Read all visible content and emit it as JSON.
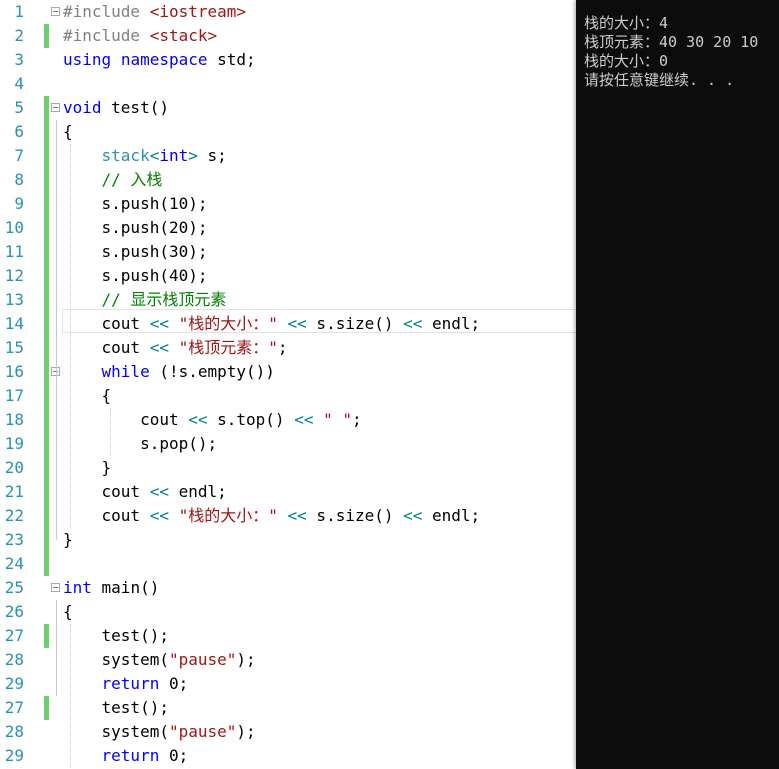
{
  "editor": {
    "lines": [
      {
        "n": "1",
        "tokens": [
          {
            "t": "#include ",
            "c": "p"
          },
          {
            "t": "<iostream>",
            "c": "s"
          }
        ]
      },
      {
        "n": "2",
        "tokens": [
          {
            "t": "#include ",
            "c": "p"
          },
          {
            "t": "<stack>",
            "c": "s"
          }
        ]
      },
      {
        "n": "3",
        "tokens": [
          {
            "t": "using",
            "c": "k"
          },
          {
            "t": " "
          },
          {
            "t": "namespace",
            "c": "k"
          },
          {
            "t": " std;"
          }
        ]
      },
      {
        "n": "4",
        "tokens": []
      },
      {
        "n": "5",
        "tokens": [
          {
            "t": "void",
            "c": "k"
          },
          {
            "t": " test()"
          }
        ]
      },
      {
        "n": "6",
        "tokens": [
          {
            "t": "{"
          }
        ]
      },
      {
        "n": "7",
        "tokens": [
          {
            "t": "    "
          },
          {
            "t": "stack",
            "c": "t"
          },
          {
            "t": "<",
            "c": "o"
          },
          {
            "t": "int",
            "c": "k"
          },
          {
            "t": ">",
            "c": "o"
          },
          {
            "t": " s;"
          }
        ]
      },
      {
        "n": "8",
        "tokens": [
          {
            "t": "    "
          },
          {
            "t": "// 入栈",
            "c": "c"
          }
        ]
      },
      {
        "n": "9",
        "tokens": [
          {
            "t": "    s.push(10);"
          }
        ]
      },
      {
        "n": "10",
        "tokens": [
          {
            "t": "    s.push(20);"
          }
        ]
      },
      {
        "n": "11",
        "tokens": [
          {
            "t": "    s.push(30);"
          }
        ]
      },
      {
        "n": "12",
        "tokens": [
          {
            "t": "    s.push(40);"
          }
        ]
      },
      {
        "n": "13",
        "tokens": [
          {
            "t": "    "
          },
          {
            "t": "// 显示栈顶元素",
            "c": "c"
          }
        ]
      },
      {
        "n": "14",
        "tokens": [
          {
            "t": "    cout "
          },
          {
            "t": "<<",
            "c": "o"
          },
          {
            "t": " "
          },
          {
            "t": "\"栈的大小：\"",
            "c": "s"
          },
          {
            "t": " "
          },
          {
            "t": "<<",
            "c": "o"
          },
          {
            "t": " s.size() "
          },
          {
            "t": "<<",
            "c": "o"
          },
          {
            "t": " endl;"
          }
        ]
      },
      {
        "n": "15",
        "tokens": [
          {
            "t": "    cout "
          },
          {
            "t": "<<",
            "c": "o"
          },
          {
            "t": " "
          },
          {
            "t": "\"栈顶元素：\"",
            "c": "s"
          },
          {
            "t": ";"
          }
        ]
      },
      {
        "n": "16",
        "tokens": [
          {
            "t": "    "
          },
          {
            "t": "while",
            "c": "k"
          },
          {
            "t": " (!s.empty())"
          }
        ]
      },
      {
        "n": "17",
        "tokens": [
          {
            "t": "    {"
          }
        ]
      },
      {
        "n": "18",
        "tokens": [
          {
            "t": "        cout "
          },
          {
            "t": "<<",
            "c": "o"
          },
          {
            "t": " s.top() "
          },
          {
            "t": "<<",
            "c": "o"
          },
          {
            "t": " "
          },
          {
            "t": "\" \"",
            "c": "s"
          },
          {
            "t": ";"
          }
        ]
      },
      {
        "n": "19",
        "tokens": [
          {
            "t": "        s.pop();"
          }
        ]
      },
      {
        "n": "20",
        "tokens": [
          {
            "t": "    }"
          }
        ]
      },
      {
        "n": "21",
        "tokens": [
          {
            "t": "    cout "
          },
          {
            "t": "<<",
            "c": "o"
          },
          {
            "t": " endl;"
          }
        ]
      },
      {
        "n": "22",
        "tokens": [
          {
            "t": "    cout "
          },
          {
            "t": "<<",
            "c": "o"
          },
          {
            "t": " "
          },
          {
            "t": "\"栈的大小：\"",
            "c": "s"
          },
          {
            "t": " "
          },
          {
            "t": "<<",
            "c": "o"
          },
          {
            "t": " s.size() "
          },
          {
            "t": "<<",
            "c": "o"
          },
          {
            "t": " endl;"
          }
        ]
      },
      {
        "n": "23",
        "tokens": [
          {
            "t": "}"
          }
        ]
      },
      {
        "n": "24",
        "tokens": []
      },
      {
        "n": "25",
        "tokens": [
          {
            "t": "int",
            "c": "k"
          },
          {
            "t": " main()"
          }
        ]
      },
      {
        "n": "26",
        "tokens": [
          {
            "t": "{"
          }
        ]
      },
      {
        "n": "27",
        "tokens": [
          {
            "t": "    test();"
          }
        ]
      },
      {
        "n": "28",
        "tokens": [
          {
            "t": "    system("
          },
          {
            "t": "\"pause\"",
            "c": "s"
          },
          {
            "t": ");"
          }
        ]
      },
      {
        "n": "29",
        "tokens": [
          {
            "t": "    "
          },
          {
            "t": "return",
            "c": "k"
          },
          {
            "t": " 0;"
          }
        ]
      },
      {
        "n": "27",
        "tokens": [
          {
            "t": "    test();"
          }
        ]
      },
      {
        "n": "28",
        "tokens": [
          {
            "t": "    system("
          },
          {
            "t": "\"pause\"",
            "c": "s"
          },
          {
            "t": ");"
          }
        ]
      },
      {
        "n": "29",
        "tokens": [
          {
            "t": "    "
          },
          {
            "t": "return",
            "c": "k"
          },
          {
            "t": " 0;"
          }
        ]
      }
    ]
  },
  "console": {
    "lines": [
      "栈的大小：4",
      "栈顶元素：40 30 20 10",
      "栈的大小：0",
      "请按任意键继续. . ."
    ]
  },
  "colors": {
    "keyword": "#0000ff",
    "preprocessor": "#808080",
    "string": "#a31515",
    "comment": "#008000",
    "type": "#2b91af",
    "operator": "#008080",
    "line_number": "#2b91af",
    "change_bar": "#6cd06c",
    "console_bg": "#0c0c0c",
    "console_text": "#cccccc"
  }
}
